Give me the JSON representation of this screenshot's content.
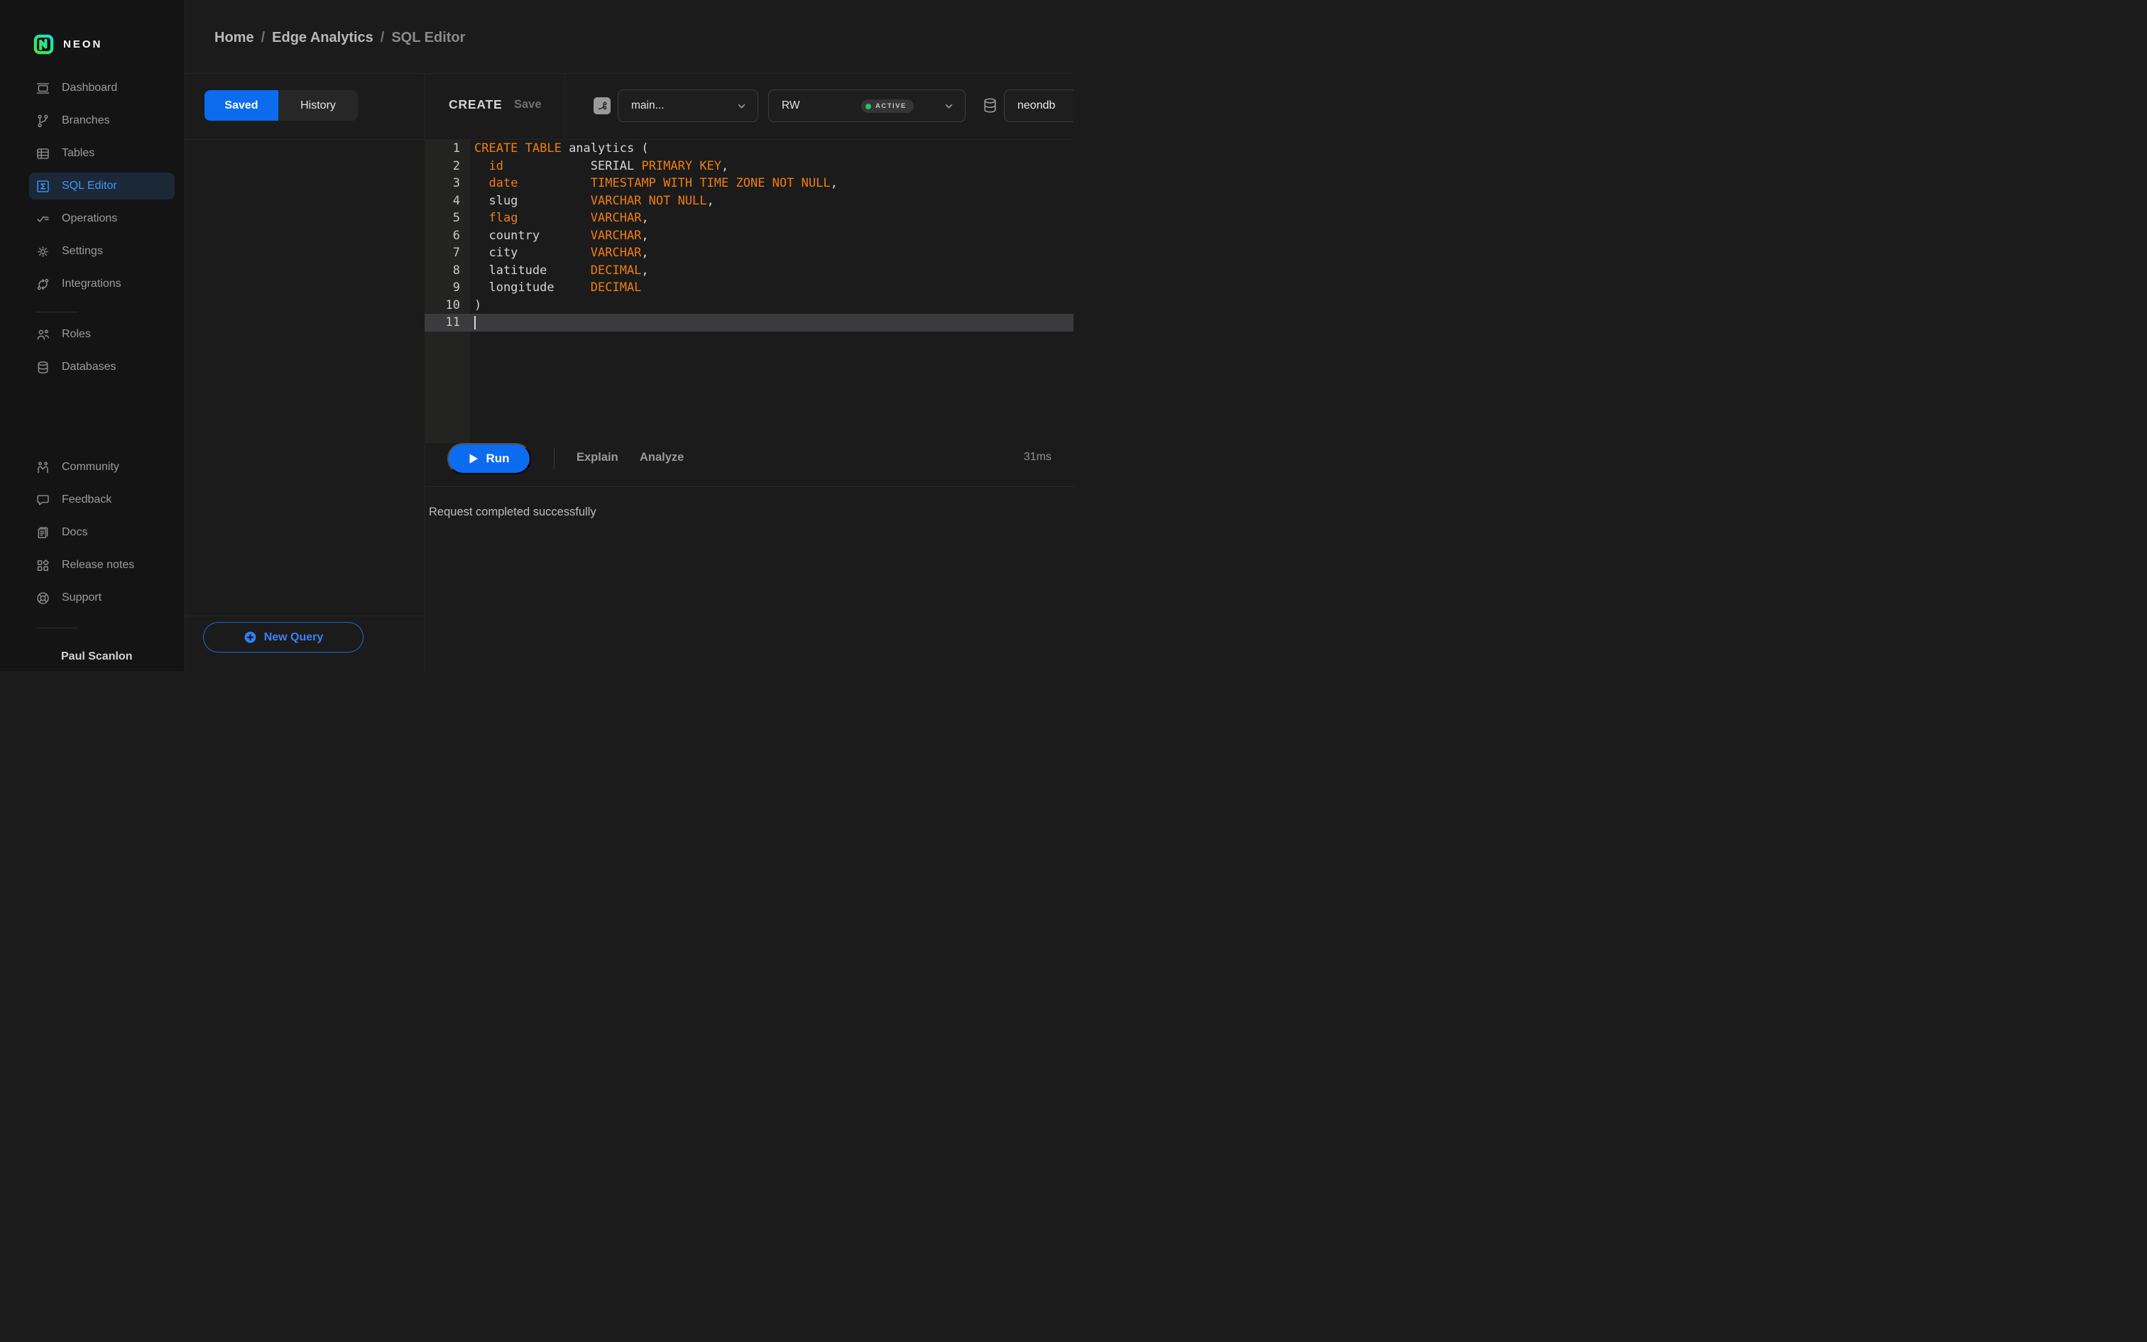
{
  "brand": {
    "name": "NEON"
  },
  "breadcrumb": {
    "separator": "/",
    "items": [
      {
        "label": "Home",
        "muted": false
      },
      {
        "label": "Edge Analytics",
        "muted": false
      },
      {
        "label": "SQL Editor",
        "muted": true
      }
    ]
  },
  "sidebar": {
    "primary": [
      {
        "icon": "dashboard",
        "label": "Dashboard",
        "active": false
      },
      {
        "icon": "branches",
        "label": "Branches",
        "active": false
      },
      {
        "icon": "tables",
        "label": "Tables",
        "active": false
      },
      {
        "icon": "sql-editor",
        "label": "SQL Editor",
        "active": true
      },
      {
        "icon": "operations",
        "label": "Operations",
        "active": false
      },
      {
        "icon": "settings",
        "label": "Settings",
        "active": false
      },
      {
        "icon": "integrations",
        "label": "Integrations",
        "active": false
      }
    ],
    "secondary": [
      {
        "icon": "roles",
        "label": "Roles",
        "active": false
      },
      {
        "icon": "databases",
        "label": "Databases",
        "active": false
      }
    ],
    "tertiary": [
      {
        "icon": "community",
        "label": "Community",
        "active": false
      },
      {
        "icon": "feedback",
        "label": "Feedback",
        "active": false
      },
      {
        "icon": "docs",
        "label": "Docs",
        "active": false
      },
      {
        "icon": "release-notes",
        "label": "Release notes",
        "active": false
      },
      {
        "icon": "support",
        "label": "Support",
        "active": false
      }
    ],
    "user": {
      "name": "Paul Scanlon"
    }
  },
  "query_panel": {
    "tabs": [
      {
        "label": "Saved",
        "active": true
      },
      {
        "label": "History",
        "active": false
      }
    ],
    "new_query_label": "New Query"
  },
  "editor": {
    "query_name": "CREATE",
    "save_label": "Save",
    "branch_select": {
      "value": "main..."
    },
    "compute_select": {
      "value": "RW",
      "badge": "ACTIVE"
    },
    "database_select": {
      "value": "neondb"
    },
    "code": {
      "lines": [
        {
          "n": "1",
          "cursor": false,
          "tokens": [
            [
              "k",
              "CREATE TABLE"
            ],
            [
              "p",
              " analytics ("
            ]
          ]
        },
        {
          "n": "2",
          "cursor": false,
          "tokens": [
            [
              "p",
              "  "
            ],
            [
              "k",
              "id"
            ],
            [
              "p",
              "            "
            ],
            [
              "p",
              "SERIAL "
            ],
            [
              "k",
              "PRIMARY KEY"
            ],
            [
              "p",
              ","
            ]
          ]
        },
        {
          "n": "3",
          "cursor": false,
          "tokens": [
            [
              "p",
              "  "
            ],
            [
              "k",
              "date"
            ],
            [
              "p",
              "          "
            ],
            [
              "k",
              "TIMESTAMP WITH TIME ZONE NOT NULL"
            ],
            [
              "p",
              ","
            ]
          ]
        },
        {
          "n": "4",
          "cursor": false,
          "tokens": [
            [
              "p",
              "  slug          "
            ],
            [
              "k",
              "VARCHAR NOT NULL"
            ],
            [
              "p",
              ","
            ]
          ]
        },
        {
          "n": "5",
          "cursor": false,
          "tokens": [
            [
              "p",
              "  "
            ],
            [
              "k",
              "flag"
            ],
            [
              "p",
              "          "
            ],
            [
              "k",
              "VARCHAR"
            ],
            [
              "p",
              ","
            ]
          ]
        },
        {
          "n": "6",
          "cursor": false,
          "tokens": [
            [
              "p",
              "  country       "
            ],
            [
              "k",
              "VARCHAR"
            ],
            [
              "p",
              ","
            ]
          ]
        },
        {
          "n": "7",
          "cursor": false,
          "tokens": [
            [
              "p",
              "  city          "
            ],
            [
              "k",
              "VARCHAR"
            ],
            [
              "p",
              ","
            ]
          ]
        },
        {
          "n": "8",
          "cursor": false,
          "tokens": [
            [
              "p",
              "  latitude      "
            ],
            [
              "k",
              "DECIMAL"
            ],
            [
              "p",
              ","
            ]
          ]
        },
        {
          "n": "9",
          "cursor": false,
          "tokens": [
            [
              "p",
              "  longitude     "
            ],
            [
              "k",
              "DECIMAL"
            ]
          ]
        },
        {
          "n": "10",
          "cursor": false,
          "tokens": [
            [
              "p",
              ")"
            ]
          ]
        },
        {
          "n": "11",
          "cursor": true,
          "tokens": []
        }
      ]
    }
  },
  "footer": {
    "run_label": "Run",
    "explain_label": "Explain",
    "analyze_label": "Analyze",
    "duration": "31ms",
    "status_message": "Request completed successfully"
  },
  "colors": {
    "accent_blue": "#0b6cf0",
    "link_blue": "#3b82f6",
    "keyword_orange": "#f07d12",
    "active_green": "#23c55e",
    "sidebar_bg": "#141414",
    "main_bg": "#1b1b1b"
  }
}
